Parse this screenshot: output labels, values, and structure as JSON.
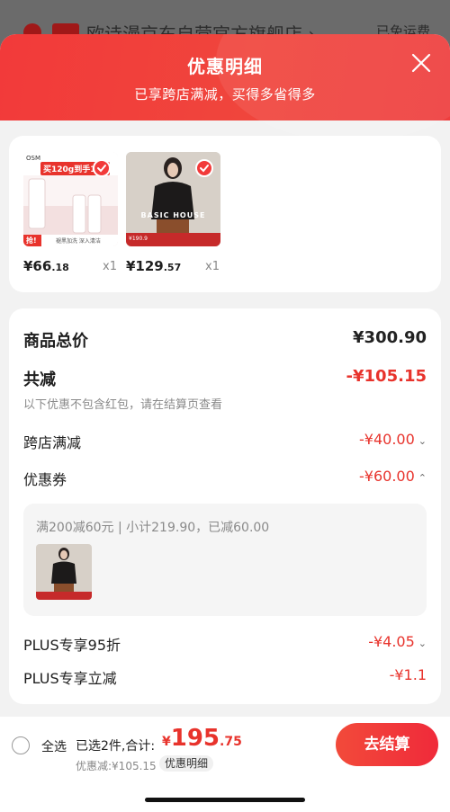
{
  "background": {
    "store_title": "欧诗漫京东自营官方旗舰店 ›",
    "right_text": "已免运费"
  },
  "sheet": {
    "title": "优惠明细",
    "subtitle": "已享跨店满减，买得多省得多"
  },
  "products": [
    {
      "price_int": "¥66",
      "price_dec": ".18",
      "qty": "x1",
      "image_badge": "买120g到手180",
      "image_tag": "抢!",
      "image_caption": "褪黑加洗 深入清洁",
      "brand": "OSM"
    },
    {
      "price_int": "¥129",
      "price_dec": ".57",
      "qty": "x1",
      "image_brand": "BASIC HOUSE",
      "image_price": "¥190.9"
    }
  ],
  "detail": {
    "total_label": "商品总价",
    "total_value": "¥300.90",
    "discount_label": "共减",
    "discount_value": "-¥105.15",
    "discount_note": "以下优惠不包含红包，请在结算页查看",
    "cross_store_label": "跨店满减",
    "cross_store_value": "-¥40.00",
    "coupon_label": "优惠券",
    "coupon_value": "-¥60.00",
    "coupon_rule": "满200减60元 | 小计219.90，已减60.00",
    "plus95_label": "PLUS专享95折",
    "plus95_value": "-¥4.05",
    "plus_direct_label": "PLUS专享立减",
    "plus_direct_value": "-¥1.1"
  },
  "bottom": {
    "select_all": "全选",
    "selected_text": "已选2件,合计:",
    "total_currency": "¥",
    "total_int": "195",
    "total_dec": ".75",
    "discount_line": "优惠减:¥105.15",
    "discount_detail_btn": "优惠明细",
    "checkout": "去结算"
  },
  "colors": {
    "accent": "#f23a3a",
    "price_red": "#e8332c"
  }
}
